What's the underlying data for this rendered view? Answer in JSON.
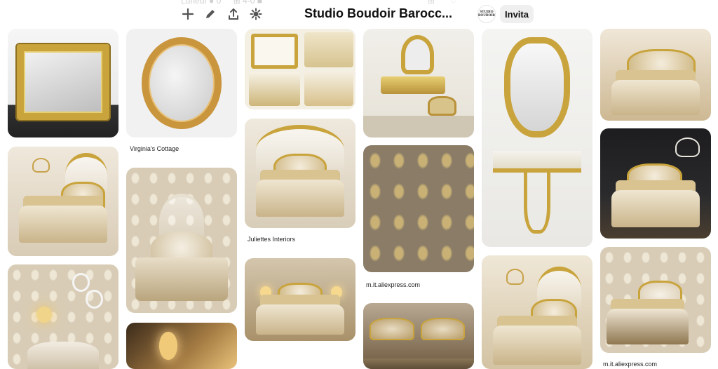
{
  "header": {
    "faint_top": [
      "Lunedì ● 0",
      "⊞ 4-0 ■"
    ],
    "faint_right": [
      "⊞",
      "♡"
    ],
    "board_title": "Studio Boudoir Barocc...",
    "avatar_text": "STUDIO\nBOUDOIR",
    "invite_label": "Invita",
    "tools": [
      "add-icon",
      "pencil-icon",
      "share-icon",
      "organize-icon"
    ]
  },
  "pins": [
    {
      "name": "pin-gold-rect-mirror",
      "caption": ""
    },
    {
      "name": "pin-oval-gold-mirror",
      "caption": "Virginia's Cottage"
    },
    {
      "name": "pin-gold-wedding-collage",
      "caption": ""
    },
    {
      "name": "pin-gold-vanity",
      "caption": ""
    },
    {
      "name": "pin-rococo-mirror-console",
      "caption": ""
    },
    {
      "name": "pin-tufted-bed-gold",
      "caption": ""
    },
    {
      "name": "pin-bed-chandelier-ivory",
      "caption": ""
    },
    {
      "name": "pin-bed-canopy-white",
      "caption": "Juliettes Interiors"
    },
    {
      "name": "pin-gold-damask-wallpaper",
      "caption": "m.it.aliexpress.com"
    },
    {
      "name": "pin-bed-black-wall",
      "caption": ""
    },
    {
      "name": "pin-wallpaper-bedroom-shell",
      "caption": ""
    },
    {
      "name": "pin-gold-bedroom-lamps",
      "caption": ""
    },
    {
      "name": "pin-bedroom-crown-canopy",
      "caption": ""
    },
    {
      "name": "pin-cream-bedroom",
      "caption": "m.it.aliexpress.com"
    },
    {
      "name": "pin-wallpaper-mirrors-wall",
      "caption": ""
    },
    {
      "name": "pin-gold-fireplace-room",
      "caption": ""
    },
    {
      "name": "pin-twin-beds-gold",
      "caption": ""
    }
  ]
}
